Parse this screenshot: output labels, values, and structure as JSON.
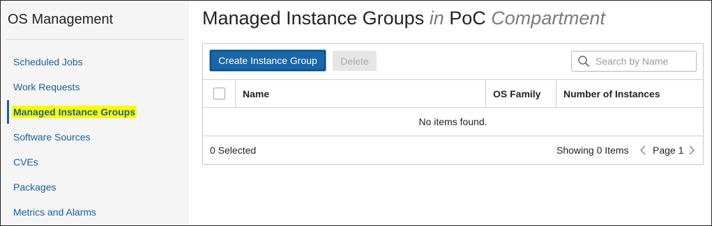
{
  "sidebar": {
    "title": "OS Management",
    "items": [
      {
        "label": "Scheduled Jobs"
      },
      {
        "label": "Work Requests"
      },
      {
        "label": "Managed Instance Groups"
      },
      {
        "label": "Software Sources"
      },
      {
        "label": "CVEs"
      },
      {
        "label": "Packages"
      },
      {
        "label": "Metrics and Alarms"
      }
    ],
    "active_item": "Managed Instance Groups"
  },
  "header": {
    "title": "Managed Instance Groups",
    "in_word": "in",
    "compartment": "PoC",
    "compartment_word": "Compartment"
  },
  "toolbar": {
    "create_label": "Create Instance Group",
    "delete_label": "Delete",
    "search_placeholder": "Search by Name"
  },
  "table": {
    "columns": [
      "Name",
      "OS Family",
      "Number of Instances"
    ],
    "empty_message": "No items found."
  },
  "footer": {
    "selected_text": "0 Selected",
    "showing_text": "Showing 0 Items",
    "page_text": "Page 1"
  },
  "colors": {
    "link": "#1a5e9b",
    "primary_button": "#1867a8",
    "highlight": "#ffff00"
  }
}
